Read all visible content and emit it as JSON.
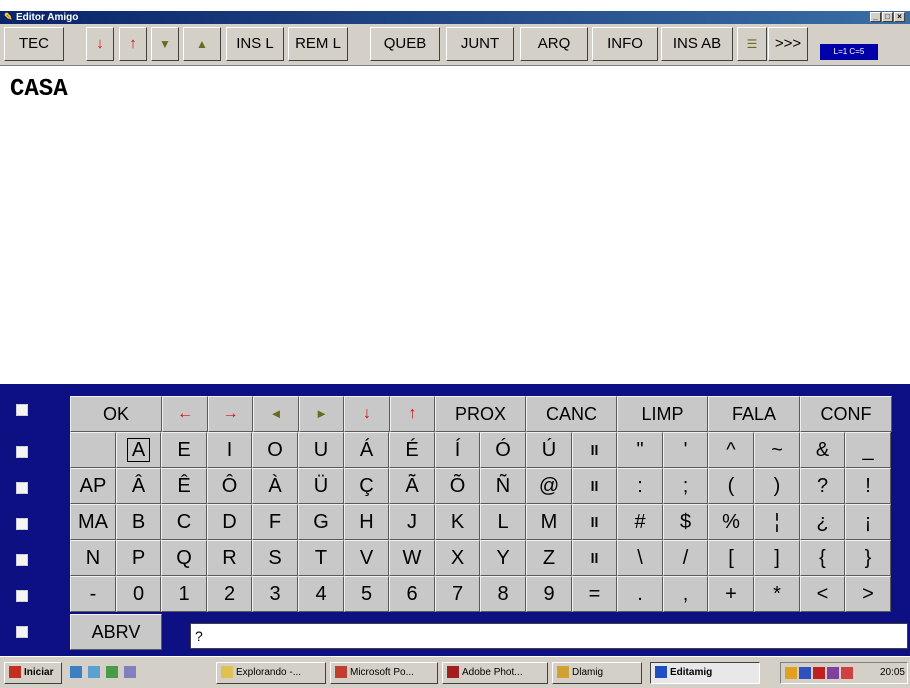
{
  "window": {
    "title": "Editor Amigo"
  },
  "toolbar": {
    "buttons": [
      "TEC",
      "↓",
      "↑",
      "▼",
      "▲",
      "INS L",
      "REM L",
      "QUEB",
      "JUNT",
      "ARQ",
      "INFO",
      "INS AB",
      "☰",
      ">>>"
    ],
    "status": "L=1 C=5"
  },
  "editor": {
    "text": "CASA"
  },
  "keyboard": {
    "row0": [
      "OK",
      "←",
      "→",
      "◄",
      "►",
      "↓",
      "↑",
      "PROX",
      "CANC",
      "LIMP",
      "FALA",
      "CONF"
    ],
    "row1": [
      "",
      "A",
      "E",
      "I",
      "O",
      "U",
      "Á",
      "É",
      "Í",
      "Ó",
      "Ú",
      "ll",
      "\"",
      "'",
      "^",
      "~",
      "&",
      "_"
    ],
    "row2": [
      "AP",
      "Â",
      "Ê",
      "Ô",
      "À",
      "Ü",
      "Ç",
      "Ã",
      "Õ",
      "Ñ",
      "@",
      "ll",
      ":",
      ";",
      "(",
      ")",
      "?",
      "!"
    ],
    "row3": [
      "MA",
      "B",
      "C",
      "D",
      "F",
      "G",
      "H",
      "J",
      "K",
      "L",
      "M",
      "ll",
      "#",
      "$",
      "%",
      "¦",
      "¿",
      "¡"
    ],
    "row4": [
      "N",
      "P",
      "Q",
      "R",
      "S",
      "T",
      "V",
      "W",
      "X",
      "Y",
      "Z",
      "ll",
      "\\",
      "/",
      "[",
      "]",
      "{",
      "}"
    ],
    "row5": [
      "-",
      "0",
      "1",
      "2",
      "3",
      "4",
      "5",
      "6",
      "7",
      "8",
      "9",
      "=",
      ".",
      ",",
      "+",
      "*",
      "<",
      ">"
    ],
    "row6": {
      "abrv": "ABRV",
      "input": "?"
    }
  },
  "taskbar": {
    "start": "Iniciar",
    "tasks": [
      "Explorando -...",
      "Microsoft Po...",
      "Adobe Phot...",
      "Dlamig",
      "Editamig"
    ],
    "clock": "20:05"
  }
}
